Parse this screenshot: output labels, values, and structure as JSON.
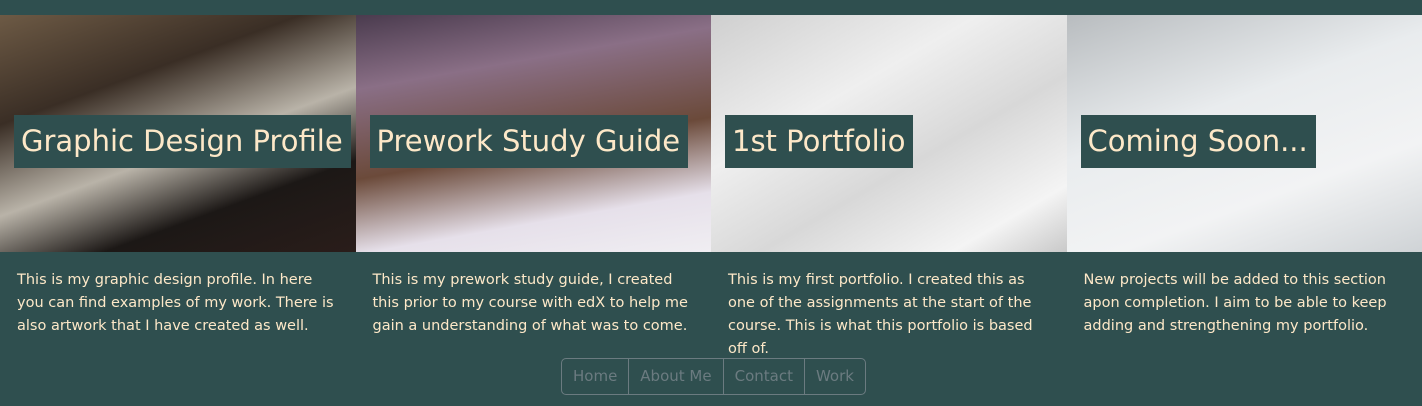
{
  "cards": [
    {
      "title": "Graphic Design Profile",
      "description": "This is my graphic design profile. In here you can find examples of my work. There is also artwork that I have created as well."
    },
    {
      "title": "Prework Study Guide",
      "description": "This is my prework study guide, I created this prior to my course with edX to help me gain a understanding of what was to come."
    },
    {
      "title": "1st Portfolio",
      "description": "This is my first portfolio. I created this as one of the assignments at the start of the course. This is what this portfolio is based off of."
    },
    {
      "title": "Coming Soon...",
      "description": "New projects will be added to this section apon completion. I aim to be able to keep adding and strengthening my portfolio."
    }
  ],
  "nav": [
    "Home",
    "About Me",
    "Contact",
    "Work"
  ],
  "colors": {
    "background": "#2f4f4f",
    "text": "#fde8c8",
    "nav": "#6b7b80"
  }
}
